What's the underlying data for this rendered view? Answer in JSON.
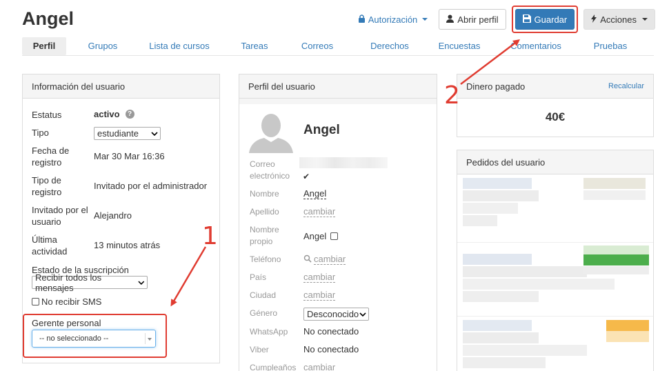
{
  "page": {
    "title": "Angel"
  },
  "topbar": {
    "authorization_label": "Autorización",
    "open_profile_label": "Abrir perfil",
    "save_label": "Guardar",
    "actions_label": "Acciones"
  },
  "tabs": [
    {
      "label": "Perfil",
      "active": true
    },
    {
      "label": "Grupos"
    },
    {
      "label": "Lista de cursos"
    },
    {
      "label": "Tareas"
    },
    {
      "label": "Correos"
    },
    {
      "label": "Derechos"
    },
    {
      "label": "Encuestas"
    },
    {
      "label": "Comentarios"
    },
    {
      "label": "Pruebas"
    }
  ],
  "user_info": {
    "title": "Información del usuario",
    "status_label": "Estatus",
    "status_value": "activo",
    "type_label": "Tipo",
    "type_value": "estudiante",
    "reg_date_label_1": "Fecha de",
    "reg_date_label_2": "registro",
    "reg_date_value": "Mar 30 Mar 16:36",
    "reg_type_label_1": "Tipo de",
    "reg_type_label_2": "registro",
    "reg_type_value": "Invitado por el administrador",
    "invited_by_label_1": "Invitado por el",
    "invited_by_label_2": "usuario",
    "invited_by_value": "Alejandro",
    "last_activity_label_1": "Última",
    "last_activity_label_2": "actividad",
    "last_activity_value": "13 minutos atrás",
    "subscription_label": "Estado de la suscripción",
    "subscription_value": "Recibir todos los mensajes",
    "no_sms_label": "No recibir SMS",
    "manager_label": "Gerente personal",
    "manager_value": "-- no seleccionado --"
  },
  "profile": {
    "title": "Perfil del usuario",
    "name": "Angel",
    "email_label_1": "Correo",
    "email_label_2": "electrónico",
    "first_name_label": "Nombre",
    "first_name_value": "Angel",
    "last_name_label": "Apellido",
    "last_name_value": "cambiar",
    "own_name_label_1": "Nombre",
    "own_name_label_2": "propio",
    "own_name_value": "Angel",
    "phone_label": "Teléfono",
    "phone_value": "cambiar",
    "country_label": "País",
    "country_value": "cambiar",
    "city_label": "Ciudad",
    "city_value": "cambiar",
    "gender_label": "Género",
    "gender_value": "Desconocido",
    "whatsapp_label": "WhatsApp",
    "whatsapp_value": "No conectado",
    "viber_label": "Viber",
    "viber_value": "No conectado",
    "birthday_label": "Cumpleaños",
    "birthday_value": "cambiar"
  },
  "money": {
    "title": "Dinero pagado",
    "recalc_label": "Recalcular",
    "amount": "40€"
  },
  "orders": {
    "title": "Pedidos del usuario"
  },
  "annotations": {
    "one": "1",
    "two": "2"
  },
  "colors": {
    "annotation": "#e03c31",
    "primary": "#337ab7"
  }
}
